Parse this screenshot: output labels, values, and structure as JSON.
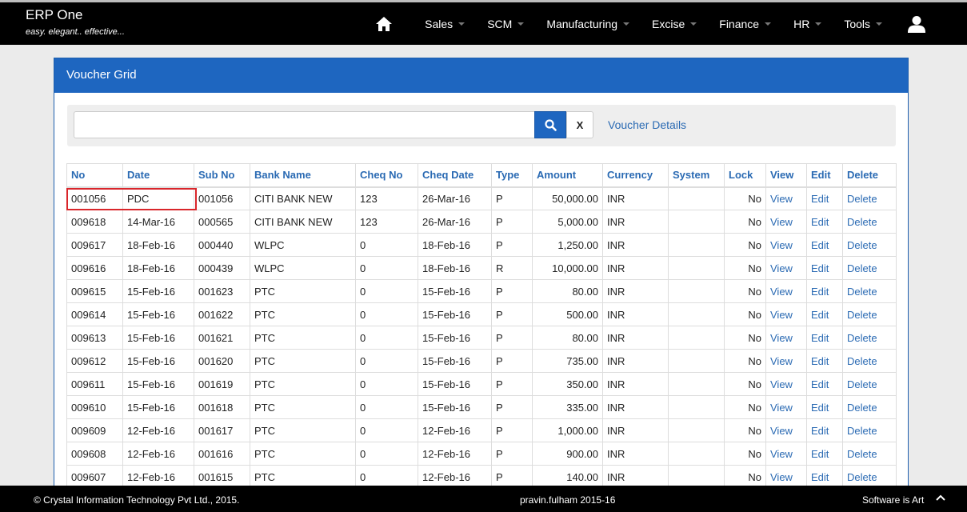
{
  "app": {
    "title": "ERP One",
    "tagline": "easy. elegant.. effective..."
  },
  "nav": {
    "items": [
      {
        "label": "Sales"
      },
      {
        "label": "SCM"
      },
      {
        "label": "Manufacturing"
      },
      {
        "label": "Excise"
      },
      {
        "label": "Finance"
      },
      {
        "label": "HR"
      },
      {
        "label": "Tools"
      }
    ]
  },
  "panel": {
    "title": "Voucher Grid"
  },
  "search": {
    "value": "",
    "placeholder": "",
    "clear_label": "X",
    "voucher_details_label": "Voucher Details"
  },
  "grid": {
    "headers": [
      "No",
      "Date",
      "Sub No",
      "Bank Name",
      "Cheq No",
      "Cheq Date",
      "Type",
      "Amount",
      "Currency",
      "System",
      "Lock",
      "View",
      "Edit",
      "Delete"
    ],
    "rows": [
      [
        "001056",
        "PDC",
        "001056",
        "CITI BANK NEW",
        "123",
        "26-Mar-16",
        "P",
        "50,000.00",
        "INR",
        "",
        "No",
        "View",
        "Edit",
        "Delete"
      ],
      [
        "009618",
        "14-Mar-16",
        "000565",
        "CITI BANK NEW",
        "123",
        "26-Mar-16",
        "P",
        "5,000.00",
        "INR",
        "",
        "No",
        "View",
        "Edit",
        "Delete"
      ],
      [
        "009617",
        "18-Feb-16",
        "000440",
        "WLPC",
        "0",
        "18-Feb-16",
        "P",
        "1,250.00",
        "INR",
        "",
        "No",
        "View",
        "Edit",
        "Delete"
      ],
      [
        "009616",
        "18-Feb-16",
        "000439",
        "WLPC",
        "0",
        "18-Feb-16",
        "R",
        "10,000.00",
        "INR",
        "",
        "No",
        "View",
        "Edit",
        "Delete"
      ],
      [
        "009615",
        "15-Feb-16",
        "001623",
        "PTC",
        "0",
        "15-Feb-16",
        "P",
        "80.00",
        "INR",
        "",
        "No",
        "View",
        "Edit",
        "Delete"
      ],
      [
        "009614",
        "15-Feb-16",
        "001622",
        "PTC",
        "0",
        "15-Feb-16",
        "P",
        "500.00",
        "INR",
        "",
        "No",
        "View",
        "Edit",
        "Delete"
      ],
      [
        "009613",
        "15-Feb-16",
        "001621",
        "PTC",
        "0",
        "15-Feb-16",
        "P",
        "80.00",
        "INR",
        "",
        "No",
        "View",
        "Edit",
        "Delete"
      ],
      [
        "009612",
        "15-Feb-16",
        "001620",
        "PTC",
        "0",
        "15-Feb-16",
        "P",
        "735.00",
        "INR",
        "",
        "No",
        "View",
        "Edit",
        "Delete"
      ],
      [
        "009611",
        "15-Feb-16",
        "001619",
        "PTC",
        "0",
        "15-Feb-16",
        "P",
        "350.00",
        "INR",
        "",
        "No",
        "View",
        "Edit",
        "Delete"
      ],
      [
        "009610",
        "15-Feb-16",
        "001618",
        "PTC",
        "0",
        "15-Feb-16",
        "P",
        "335.00",
        "INR",
        "",
        "No",
        "View",
        "Edit",
        "Delete"
      ],
      [
        "009609",
        "12-Feb-16",
        "001617",
        "PTC",
        "0",
        "12-Feb-16",
        "P",
        "1,000.00",
        "INR",
        "",
        "No",
        "View",
        "Edit",
        "Delete"
      ],
      [
        "009608",
        "12-Feb-16",
        "001616",
        "PTC",
        "0",
        "12-Feb-16",
        "P",
        "900.00",
        "INR",
        "",
        "No",
        "View",
        "Edit",
        "Delete"
      ],
      [
        "009607",
        "12-Feb-16",
        "001615",
        "PTC",
        "0",
        "12-Feb-16",
        "P",
        "140.00",
        "INR",
        "",
        "No",
        "View",
        "Edit",
        "Delete"
      ]
    ]
  },
  "footer": {
    "copyright": "© Crystal Information Technology Pvt Ltd., 2015.",
    "user": "pravin.fulham 2015-16",
    "slogan": "Software is Art"
  },
  "colors": {
    "navbar": "#000000",
    "panel_header": "#1e66c0",
    "link": "#2a6ab3",
    "highlight": "#d9262b"
  }
}
